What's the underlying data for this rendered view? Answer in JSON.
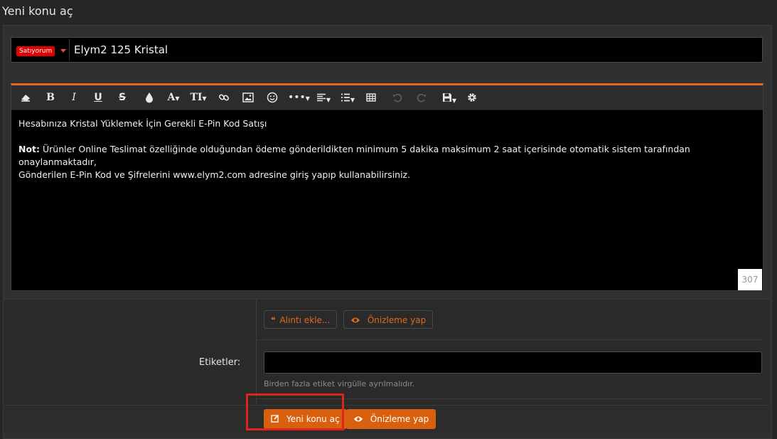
{
  "page": {
    "title": "Yeni konu aç"
  },
  "title_row": {
    "prefix": "Satıyorum",
    "title_value": "Elym2 125 Kristal"
  },
  "toolbar": {
    "icons": [
      "eraser-icon",
      "bold-icon",
      "italic-icon",
      "underline-icon",
      "strikethrough-icon",
      "color-icon",
      "font-size-icon",
      "text-style-icon",
      "link-icon",
      "image-icon",
      "smiley-icon",
      "more-icon",
      "align-icon",
      "list-icon",
      "table-icon",
      "undo-icon",
      "redo-icon",
      "save-draft-icon",
      "gear-icon"
    ],
    "glyphs": {
      "bold": "B",
      "italic": "I",
      "underline": "U",
      "strike": "S",
      "font": "A",
      "style": "TI"
    }
  },
  "editor": {
    "line1": "Hesabınıza Kristal Yüklemek İçin Gerekli E-Pin Kod Satışı",
    "note_label": "Not:",
    "note_text": " Ürünler Online Teslimat özelliğinde olduğundan ödeme gönderildikten minimum 5 dakika maksimum 2 saat içerisinde otomatik sistem tarafından onaylanmaktadır,",
    "line3": "Gönderilen E-Pin Kod ve Şifrelerini www.elym2.com adresine giriş yapıp kullanabilirsiniz.",
    "char_count": "307"
  },
  "actions": {
    "quote_label": "Alıntı ekle...",
    "preview_label": "Önizleme yap"
  },
  "tags": {
    "label": "Etiketler:",
    "value": "",
    "hint": "Birden fazla etiket virgülle ayrılmalıdır."
  },
  "submit": {
    "create_label": "Yeni konu aç",
    "preview_label": "Önizleme yap"
  },
  "colors": {
    "accent": "#d9600e",
    "highlight": "#e0231d",
    "prefix_bg": "#e00000"
  }
}
